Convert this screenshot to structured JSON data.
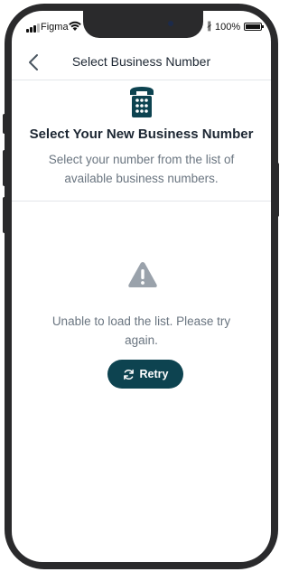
{
  "status_bar": {
    "carrier": "Figma",
    "battery_percent": "100%",
    "battery_level": 1.0
  },
  "nav": {
    "title": "Select Business Number",
    "back_icon": "chevron-left-icon"
  },
  "header": {
    "icon": "phone-keypad-icon",
    "title": "Select Your New Business Number",
    "subtitle": "Select your number from the list of available business numbers."
  },
  "error": {
    "icon": "warning-icon",
    "message": "Unable to load the list. Please try again.",
    "retry_label": "Retry",
    "retry_icon": "refresh-icon"
  },
  "colors": {
    "accent": "#0d4350",
    "muted_text": "#6a7580",
    "warning_gray": "#9aa2ab",
    "title_text": "#1d2733"
  }
}
